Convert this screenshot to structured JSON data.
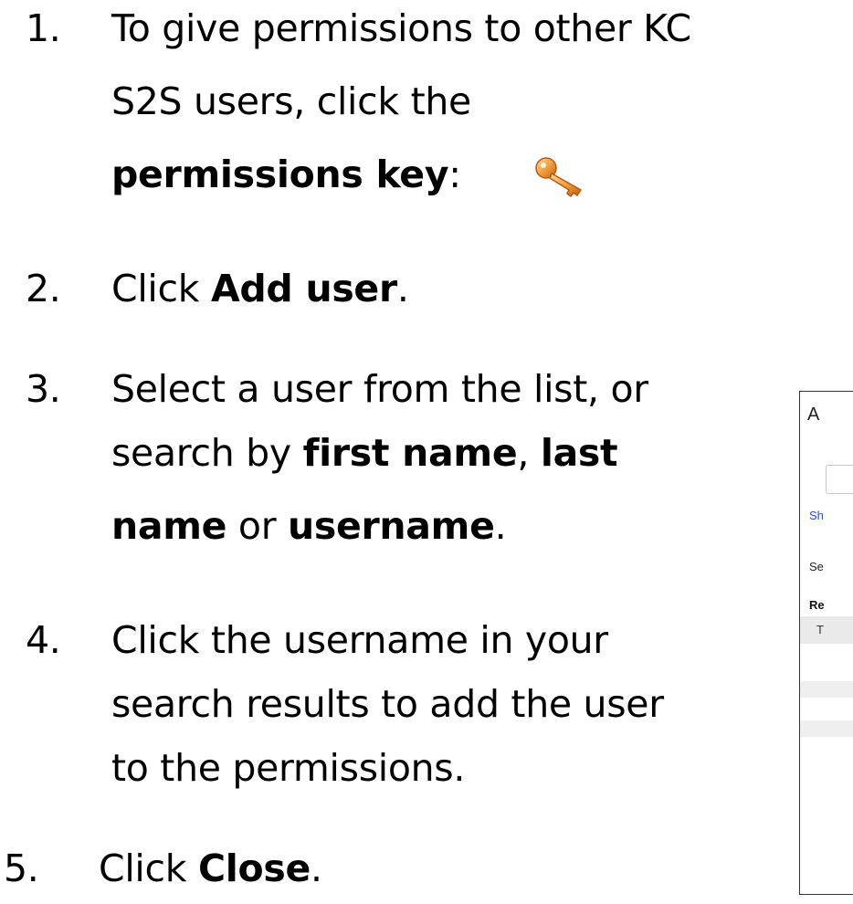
{
  "steps": [
    {
      "number": "1.",
      "lines": [
        [
          {
            "t": "To give permissions to other KC"
          }
        ],
        [
          {
            "t": "S2S users, click the"
          }
        ],
        [
          {
            "t": "permissions key",
            "b": true
          },
          {
            "t": ":"
          }
        ]
      ]
    },
    {
      "number": "2.",
      "lines": [
        [
          {
            "t": "Click "
          },
          {
            "t": "Add user",
            "b": true
          },
          {
            "t": "."
          }
        ]
      ]
    },
    {
      "number": "3.",
      "lines": [
        [
          {
            "t": "Select a user from the list, or"
          }
        ],
        [
          {
            "t": "search by "
          },
          {
            "t": "first name",
            "b": true
          },
          {
            "t": ", "
          },
          {
            "t": "last",
            "b": true
          }
        ],
        [
          {
            "t": "name",
            "b": true
          },
          {
            "t": " or "
          },
          {
            "t": "username",
            "b": true
          },
          {
            "t": "."
          }
        ]
      ]
    },
    {
      "number": "4.",
      "lines": [
        [
          {
            "t": "Click the username in your"
          }
        ],
        [
          {
            "t": "search results to add the user"
          }
        ],
        [
          {
            "t": "to the permissions."
          }
        ]
      ]
    },
    {
      "number": "5.",
      "lines": [
        [
          {
            "t": "Click "
          },
          {
            "t": "Close",
            "b": true
          },
          {
            "t": "."
          }
        ]
      ]
    }
  ],
  "icons": {
    "permissions_key": "key-icon"
  },
  "dialog_crop": {
    "title": "A",
    "link": "Sh",
    "text1": "Se",
    "text2": "Re",
    "header_cell": "T"
  },
  "colors": {
    "key": "#f0a040",
    "link": "#2a4fd0"
  }
}
